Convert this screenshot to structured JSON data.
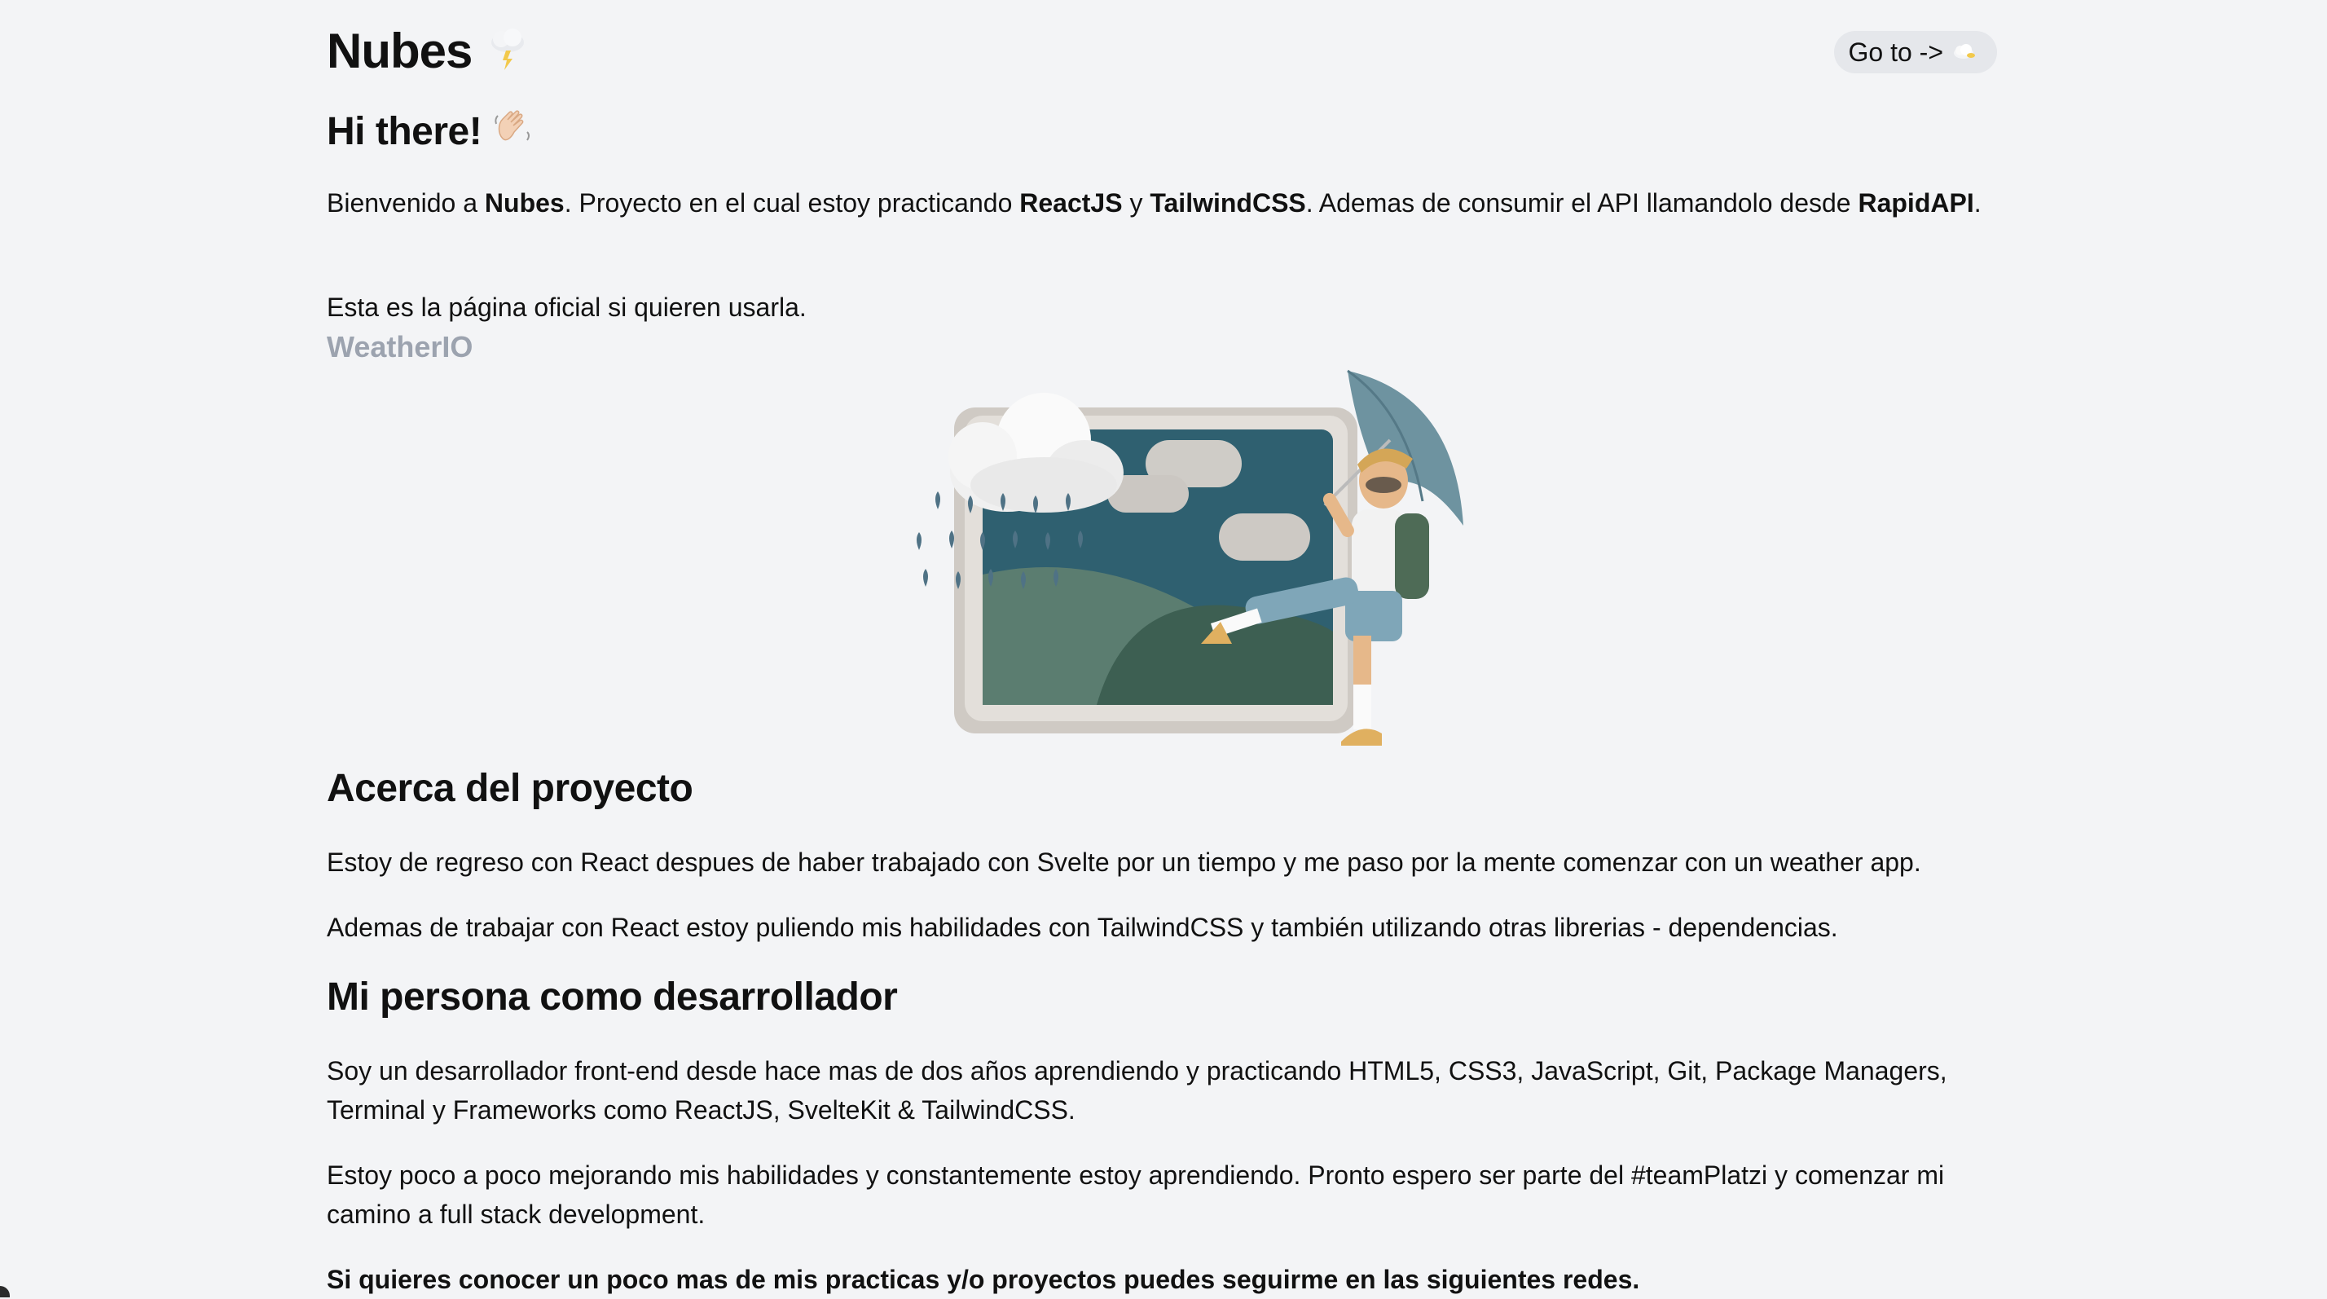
{
  "header": {
    "title": "Nubes",
    "title_icon": "cloud-lightning-icon",
    "goto_label": "Go to ->",
    "goto_icon": "cloud-icon"
  },
  "intro": {
    "heading": "Hi there!",
    "heading_icon": "waving-hand-icon",
    "p1_a": "Bienvenido a ",
    "p1_b": "Nubes",
    "p1_c": ". Proyecto en el cual estoy practicando ",
    "p1_d": "ReactJS",
    "p1_e": " y ",
    "p1_f": "TailwindCSS",
    "p1_g": ". Ademas de consumir el API llamandolo desde ",
    "p1_h": "RapidAPI",
    "p1_i": ".",
    "p2": "Esta es la página oficial si quieren usarla.",
    "link": "WeatherIO"
  },
  "hero": {
    "image": "weather-illustration-kid-with-umbrella"
  },
  "about": {
    "heading": "Acerca del proyecto",
    "p1": "Estoy de regreso con React despues de haber trabajado con Svelte por un tiempo y me paso por la mente comenzar con un weather app.",
    "p2": "Ademas de trabajar con React estoy puliendo mis habilidades con TailwindCSS y también utilizando otras librerias - dependencias."
  },
  "dev": {
    "heading": "Mi persona como desarrollador",
    "p1": "Soy un desarrollador front-end desde hace mas de dos años aprendiendo y practicando HTML5, CSS3, JavaScript, Git, Package Managers, Terminal y Frameworks como ReactJS, SvelteKit & TailwindCSS.",
    "p2": "Estoy poco a poco mejorando mis habilidades y constantemente estoy aprendiendo. Pronto espero ser parte del #teamPlatzi y comenzar mi camino a full stack development.",
    "p3": "Si quieres conocer un poco mas de mis practicas y/o proyectos puedes seguirme en las siguientes redes."
  },
  "colors": {
    "background": "#f3f4f6",
    "button_bg": "#e5e7eb",
    "link": "#9ca3af",
    "text": "#111111"
  }
}
